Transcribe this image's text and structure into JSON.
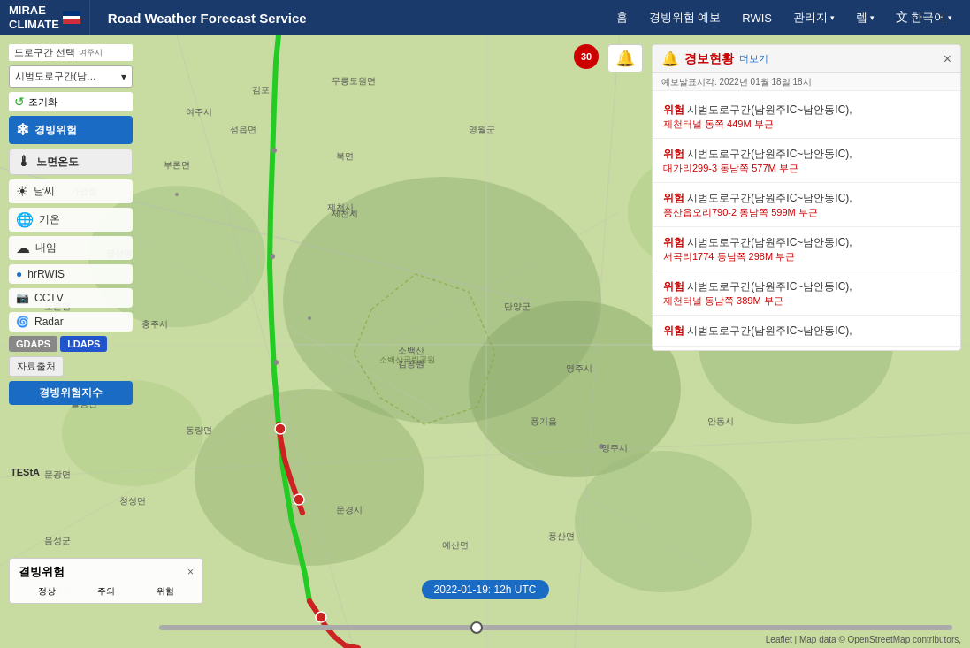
{
  "header": {
    "logo_line1": "MIRAE",
    "logo_line2": "CLIMATE",
    "service_title": "Road Weather Forecast Service",
    "nav": {
      "home": "홈",
      "gyeongbing_yebo": "경빙위험 예보",
      "rwis": "RWIS",
      "gwanri": "관리지",
      "reop": "렙",
      "lang": "한국어"
    }
  },
  "left_panel": {
    "road_select_label": "도로구간 선택",
    "road_select_placeholder": "시범도로구간(남원주IC-...",
    "refresh_label": "조기화",
    "gyeongbing_label": "경빙위험",
    "noyeon_label": "노면온도",
    "weather_label": "날씨",
    "gion_label": "기온",
    "naeim_label": "내임",
    "rwis_label": "hrRWIS",
    "cctv_label": "CCTV",
    "radar_label": "Radar",
    "gdaps_label": "GDAPS",
    "ldaps_label": "LDAPS",
    "jaryocheje_label": "자료출처",
    "gyeongbing_jisu_label": "경빙위험지수"
  },
  "alert_panel": {
    "title": "경보현황",
    "more_btn": "더보기",
    "timestamp_label": "예보발표시각: 2022년 01월 18일 18시",
    "items": [
      {
        "label": "위험",
        "text": "시범도로구간(남원주IC~남안동IC),",
        "location": "제천터널 동쪽 449M 부근"
      },
      {
        "label": "위험",
        "text": "시범도로구간(남원주IC~남안동IC),",
        "location": "대가리299-3 동남쪽 577M 부근"
      },
      {
        "label": "위험",
        "text": "시범도로구간(남원주IC~남안동IC),",
        "location": "풍산읍오리790-2 동남쪽 599M 부근"
      },
      {
        "label": "위험",
        "text": "시범도로구간(남원주IC~남안동IC),",
        "location": "서곡리1774 동남쪽 298M 부근"
      },
      {
        "label": "위험",
        "text": "시범도로구간(남원주IC~남안동IC),",
        "location": "제천터널 동남쪽 389M 부근"
      },
      {
        "label": "위험",
        "text": "시범도로구간(남원주IC~남안동IC),",
        "location": ""
      }
    ]
  },
  "legend": {
    "title": "결빙위험",
    "close_icon": "×",
    "items": [
      {
        "label": "정상",
        "color": "#22aa22"
      },
      {
        "label": "주의",
        "color": "#ffcc00"
      },
      {
        "label": "위험",
        "color": "#cc0000"
      }
    ]
  },
  "date_label": "2022-01-19: 12h UTC",
  "attribution": "Leaflet | Map data © OpenStreetMap contributors,",
  "road_limit": "30",
  "testa_label": "TEStA"
}
